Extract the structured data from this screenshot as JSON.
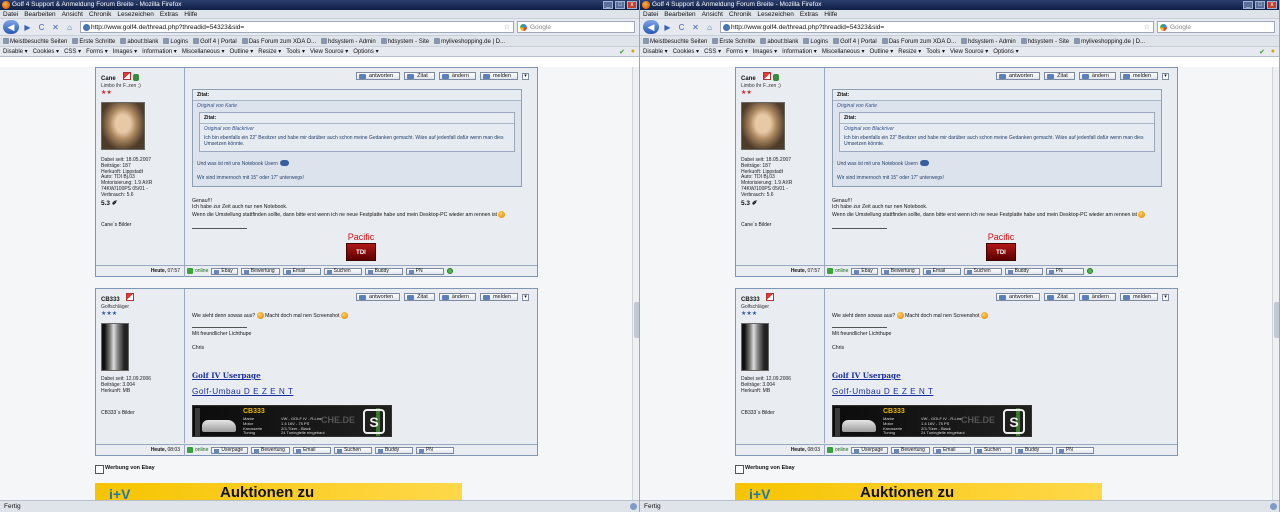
{
  "window": {
    "title": "Golf 4 Support & Anmeldung Forum Breite - Mozilla Firefox",
    "min": "_",
    "max": "□",
    "close": "x"
  },
  "menu": [
    "Datei",
    "Bearbeiten",
    "Ansicht",
    "Chronik",
    "Lesezeichen",
    "Extras",
    "Hilfe"
  ],
  "nav": {
    "back": "◀",
    "forward": "▶",
    "reload": "C",
    "stop": "✕",
    "home": "⌂",
    "url": "http://www.golf4.de/thread.php?threadid=54323&sid=",
    "star": "☆",
    "search_placeholder": "Google"
  },
  "bookmarks": [
    "Meistbesuchte Seiten",
    "Erste Schritte",
    "about:blank",
    "Logins",
    "Golf 4 | Portal",
    "Das Forum zum XDA D...",
    "hdsystem - Admin",
    "hdsystem - Site",
    "myliveshopping.de | D..."
  ],
  "devtoolbar": [
    "Disable ▾",
    "Cookies ▾",
    "CSS ▾",
    "Forms ▾",
    "Images ▾",
    "Information ▾",
    "Miscellaneous ▾",
    "Outline ▾",
    "Resize ▾",
    "Tools ▾",
    "View Source ▾",
    "Options ▾"
  ],
  "devicons": {
    "ok": "✔",
    "warn": "●"
  },
  "post_buttons": [
    "antworten",
    "Zitat",
    "ändern",
    "melden"
  ],
  "post_menu_icon": "▾",
  "footer_buttons_1": [
    "online",
    "Ebay",
    "Bewertung",
    "Email",
    "Suchen",
    "Buddy",
    "PN"
  ],
  "footer_buttons_2": [
    "online",
    "Userpage",
    "Bewertung",
    "Email",
    "Suchen",
    "Buddy",
    "PN"
  ],
  "post1": {
    "username": "Cane",
    "usertitle": "Limbo ihr F..zen ;)",
    "stars": "★★",
    "stats": "Dabei seit: 18.05.2007\nBeiträge: 187\nHerkunft: Lippstadt\nAuto: TDI Bj.03\nMotorisierung: 1.9 AXR\n74KW/100PS 05/01 -\nVerbrauch: 5.6",
    "mpg": "5.3 ✐",
    "pics": "Cane`s Bilder",
    "quote_head": "Zitat:",
    "quote_by": "Original von Karte",
    "inner_head": "Zitat:",
    "inner_by": "Original von Blackriver",
    "inner_text": "Ich bin ebenfalls ein 22\" Besitzer und habe mir darüber auch schon meine Gedanken gemacht. Wäre auf jedenfall dafür wenn man dies Umsetzen könnte.",
    "quote_line1": "Und was ist mit uns Notebook Usern",
    "quote_line2": "Wir sind immernoch mit 15\" oder 17\" unterwegs!",
    "body_line1": "Genau!!!",
    "body_line2": "Ich habe zur Zeit auch nur nen Notebook.",
    "body_line3": "Wenn die Umstellung stattfinden sollte, dann bitte erst wenn ich ne neue Festplatte habe und mein Desktop-PC wieder am rennen ist",
    "sig_pacific": "Pacific",
    "sig_tdi": "TDI",
    "date_label": "Heute,",
    "date_time": "07:57"
  },
  "post2": {
    "username": "CB333",
    "usertitle": "Golfschläger",
    "stars": "★★★",
    "stats": "Dabei seit: 12.09.2006\nBeiträge: 3.004\nHerkunft: MB",
    "pics": "CB333`s Bilder",
    "body_line1a": "Wie sieht denn sowas aus?",
    "body_line1b": "Macht doch mal nen Screenshot",
    "greeting": "Mit freundlicher Lichthupe",
    "name": "Chris",
    "link1": "Golf IV Userpage",
    "link2": "Golf-Umbau D E Z E N T",
    "banner_name": "CB333",
    "banner_specs": "Marke\nMotor\nKarosserie\nTuning",
    "banner_specs2": "VW - GOLF IV - R-Line\n1.4 16V - 75 PS\n2/3-Türer - Black\n24 Tuningteile eingebaut",
    "banner_site": "CHE.DE",
    "banner_logo": "S",
    "date_label": "Heute,",
    "date_time": "08:03"
  },
  "ebay": {
    "head": "Werbung von Ebay",
    "banner": "Auktionen zu",
    "logo": "i+V"
  },
  "status": "Fertig"
}
